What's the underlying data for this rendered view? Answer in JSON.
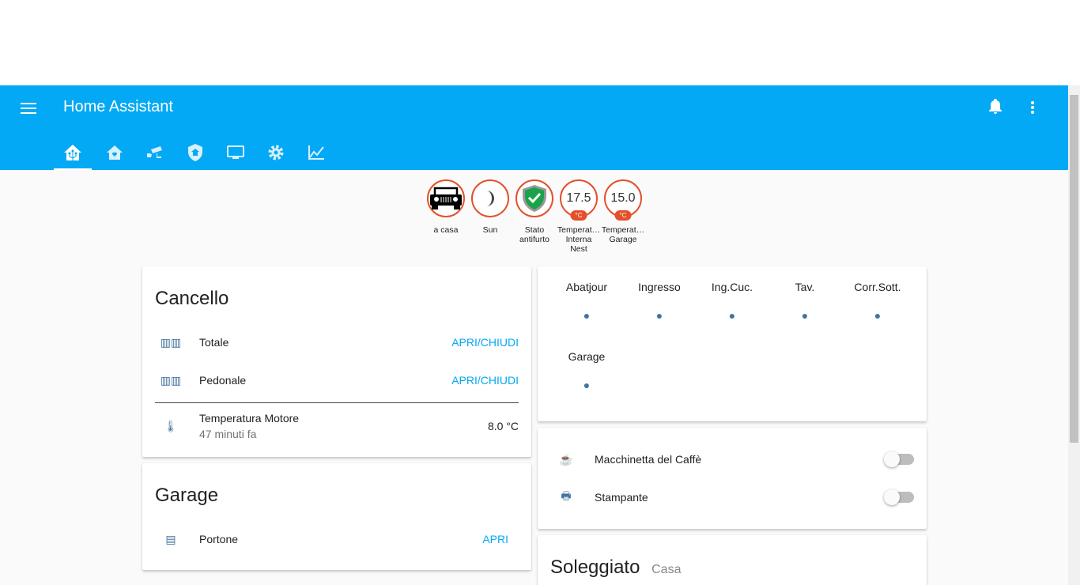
{
  "header": {
    "title": "Home Assistant"
  },
  "tabs": [
    {
      "icon": "home-assistant-icon"
    },
    {
      "icon": "home-heart-icon"
    },
    {
      "icon": "cctv-icon"
    },
    {
      "icon": "shield-home-icon"
    },
    {
      "icon": "monitor-icon"
    },
    {
      "icon": "gear-icon"
    },
    {
      "icon": "chart-line-icon"
    }
  ],
  "badges": [
    {
      "label": "a casa",
      "icon": "jeep-icon"
    },
    {
      "label": "Sun",
      "icon": "moon-icon"
    },
    {
      "label": "Stato antifurto",
      "icon": "shield-check-icon"
    },
    {
      "label": "Temperat… Interna Nest",
      "value": "17.5",
      "unit": "°C"
    },
    {
      "label": "Temperat… Garage",
      "value": "15.0",
      "unit": "°C"
    }
  ],
  "cancello": {
    "title": "Cancello",
    "rows": [
      {
        "name": "Totale",
        "action": "APRI/CHIUDI"
      },
      {
        "name": "Pedonale",
        "action": "APRI/CHIUDI"
      }
    ],
    "sensor": {
      "name": "Temperatura Motore",
      "sub": "47 minuti fa",
      "value": "8.0 °C"
    }
  },
  "garage": {
    "title": "Garage",
    "rows": [
      {
        "name": "Portone",
        "action": "APRI"
      }
    ]
  },
  "lights": [
    "Abatjour",
    "Ingresso",
    "Ing.Cuc.",
    "Tav.",
    "Corr.Sott.",
    "Garage"
  ],
  "switches": [
    {
      "name": "Macchinetta del Caffè"
    },
    {
      "name": "Stampante"
    }
  ],
  "soleggiato": {
    "title": "Soleggiato",
    "subtitle": "Casa"
  },
  "colors": {
    "primary": "#03a9f4",
    "badge": "#e4502a",
    "icon": "#44739e"
  }
}
